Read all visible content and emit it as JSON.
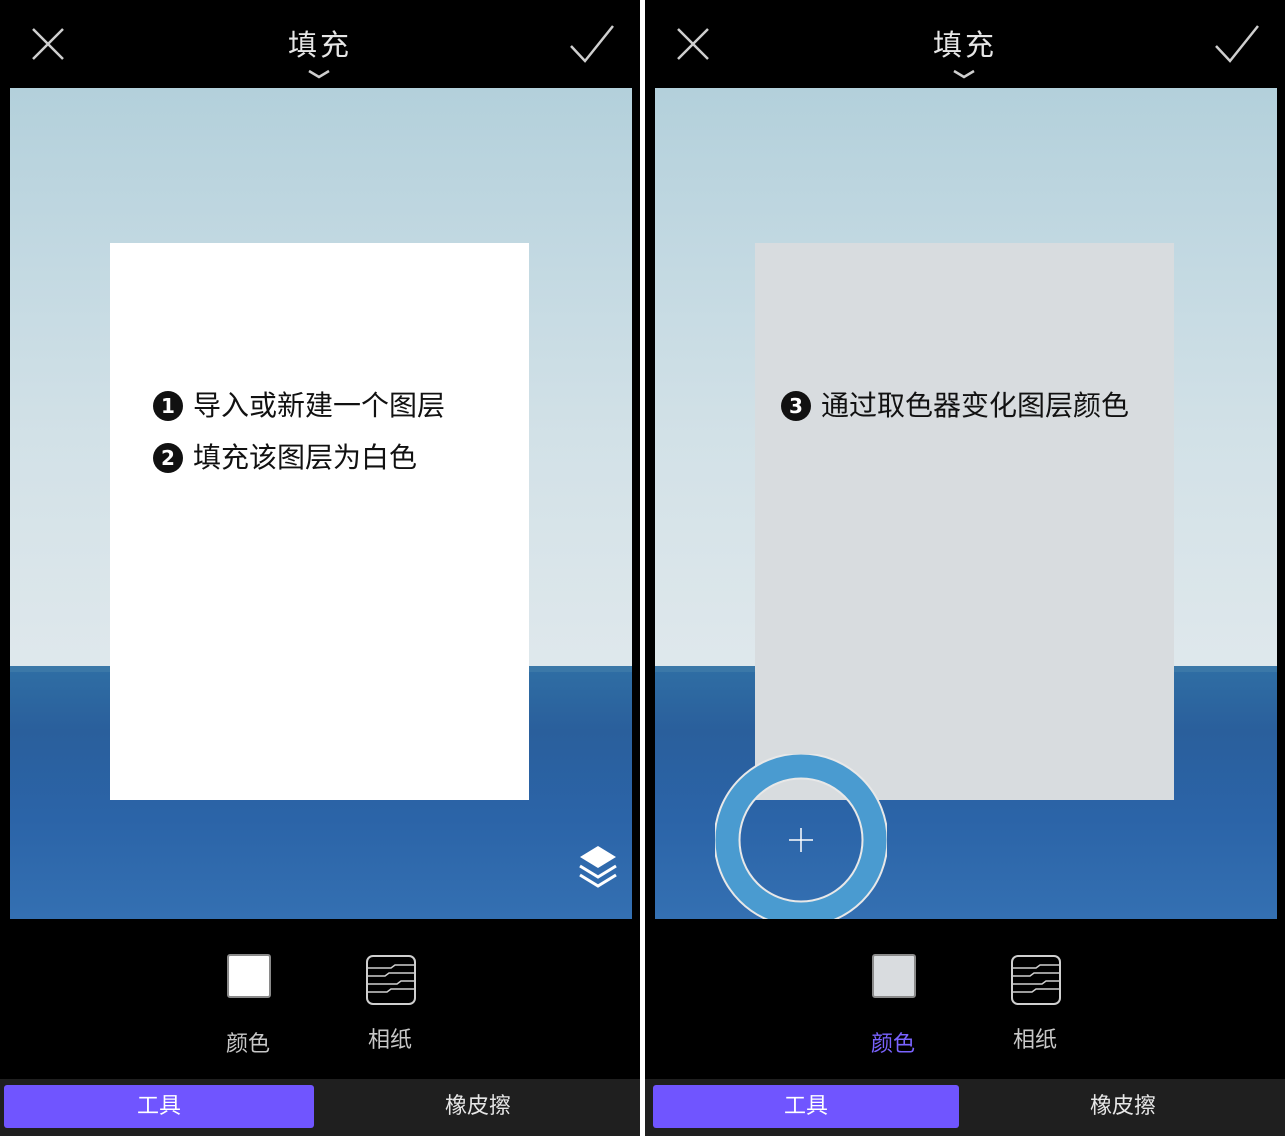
{
  "header": {
    "title": "填充",
    "close_icon": "close-icon",
    "confirm_icon": "check-icon"
  },
  "left_canvas": {
    "notes": [
      "导入或新建一个图层",
      "填充该图层为白色"
    ],
    "note_numbers": [
      "1",
      "2"
    ],
    "layer_color": "#ffffff"
  },
  "right_canvas": {
    "notes": [
      "通过取色器变化图层颜色"
    ],
    "note_numbers": [
      "3"
    ],
    "layer_color": "#d8dcdf"
  },
  "tools": {
    "color_label": "颜色",
    "paper_label": "相纸"
  },
  "tabs": {
    "tool": "工具",
    "eraser": "橡皮擦"
  },
  "colors": {
    "accent": "#7055ff",
    "active_label": "#7a63ff",
    "background": "#000000"
  }
}
